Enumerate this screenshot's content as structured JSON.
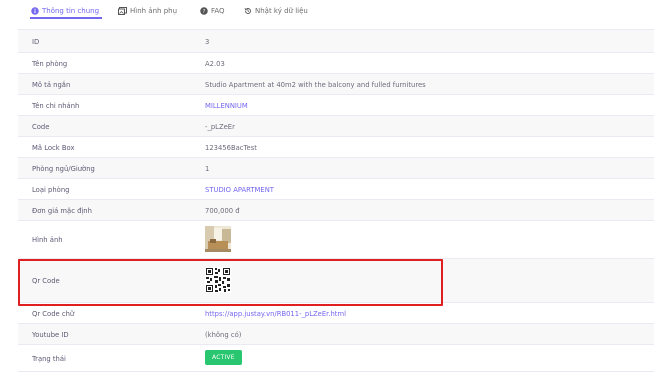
{
  "tabs": [
    {
      "label": "Thông tin chung",
      "icon": "info-circle-icon",
      "active": true
    },
    {
      "label": "Hình ảnh phụ",
      "icon": "image-icon",
      "active": false
    },
    {
      "label": "FAQ",
      "icon": "help-circle-icon",
      "active": false
    },
    {
      "label": "Nhật ký dữ liệu",
      "icon": "history-icon",
      "active": false
    }
  ],
  "rows": {
    "id": {
      "label": "ID",
      "value": "3"
    },
    "room_name": {
      "label": "Tên phòng",
      "value": "A2.03"
    },
    "short_desc": {
      "label": "Mô tả ngắn",
      "value": "Studio Apartment at 40m2 with the balcony and fulled furnitures"
    },
    "branch": {
      "label": "Tên chi nhánh",
      "value": "MILLENNIUM"
    },
    "code": {
      "label": "Code",
      "value": "-_pLZeEr"
    },
    "lockbox": {
      "label": "Mã Lock Box",
      "value": "123456BacTest"
    },
    "beds": {
      "label": "Phòng ngủ/Giường",
      "value": "1"
    },
    "room_type": {
      "label": "Loại phòng",
      "value": "STUDIO APARTMENT"
    },
    "price": {
      "label": "Đơn giá mặc định",
      "value": "700,000 đ"
    },
    "image": {
      "label": "Hình ảnh"
    },
    "qr": {
      "label": "Qr Code"
    },
    "qr_text": {
      "label": "Qr Code chữ",
      "value": "https://app.justay.vn/RB011-_pLZeEr.html"
    },
    "youtube": {
      "label": "Youtube ID",
      "value": "(không có)"
    },
    "status": {
      "label": "Trạng thái",
      "value": "ACTIVE"
    }
  },
  "colors": {
    "accent": "#7367f0",
    "status_active": "#28c76f",
    "highlight_border": "#e02020"
  }
}
